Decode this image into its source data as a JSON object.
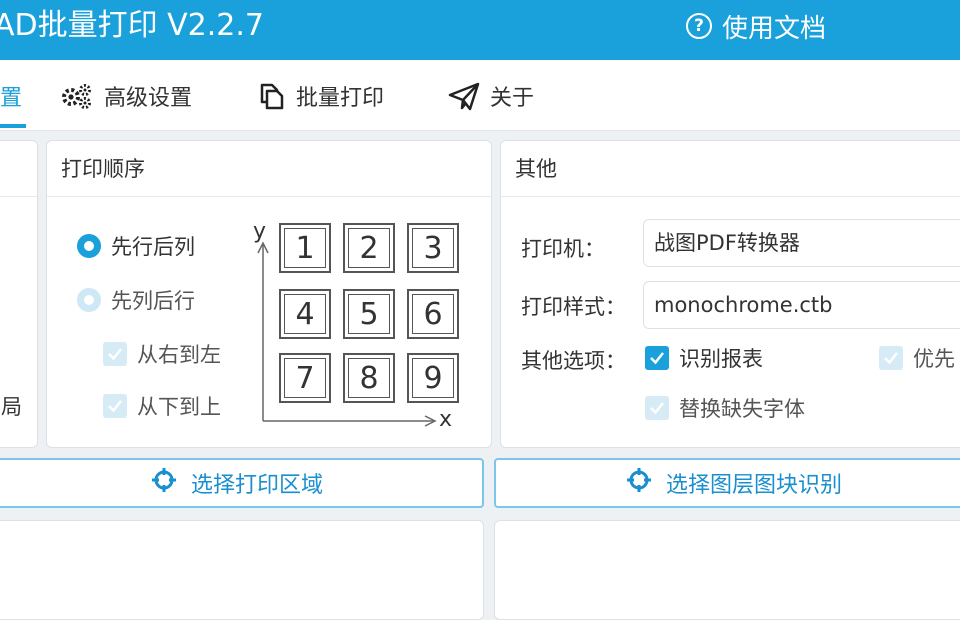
{
  "titlebar": {
    "title": "AD批量打印 V2.2.7",
    "help_label": "使用文档",
    "help_icon": "question-circle-icon"
  },
  "tabs": [
    {
      "label": "置",
      "icon": "",
      "active": true
    },
    {
      "label": "高级设置",
      "icon": "gears-icon",
      "active": false
    },
    {
      "label": "批量打印",
      "icon": "copy-files-icon",
      "active": false
    },
    {
      "label": "关于",
      "icon": "paper-plane-icon",
      "active": false
    }
  ],
  "left_panel": {
    "fragments": [
      "局"
    ]
  },
  "print_order": {
    "header": "打印顺序",
    "options": [
      {
        "label": "先行后列",
        "selected": true
      },
      {
        "label": "先列后行",
        "selected": false
      }
    ],
    "checks": [
      {
        "label": "从右到左",
        "checked": true,
        "enabled": false
      },
      {
        "label": "从下到上",
        "checked": true,
        "enabled": false
      }
    ],
    "grid": [
      "1",
      "2",
      "3",
      "4",
      "5",
      "6",
      "7",
      "8",
      "9"
    ],
    "axis_x": "x",
    "axis_y": "y"
  },
  "other": {
    "header": "其他",
    "printer_label": "打印机：",
    "printer_value": "战图PDF转换器",
    "style_label": "打印样式：",
    "style_value": "monochrome.ctb",
    "options_label": "其他选项：",
    "options": [
      {
        "label": "识别报表",
        "checked": true,
        "enabled": true
      },
      {
        "label": "优先",
        "checked": true,
        "enabled": false
      },
      {
        "label": "替换缺失字体",
        "checked": true,
        "enabled": false
      }
    ]
  },
  "actions": {
    "select_area": "选择打印区域",
    "select_layer": "选择图层图块识别",
    "icon": "crosshair-icon"
  },
  "colors": {
    "accent": "#1aa0db",
    "background": "#eef1f4"
  }
}
